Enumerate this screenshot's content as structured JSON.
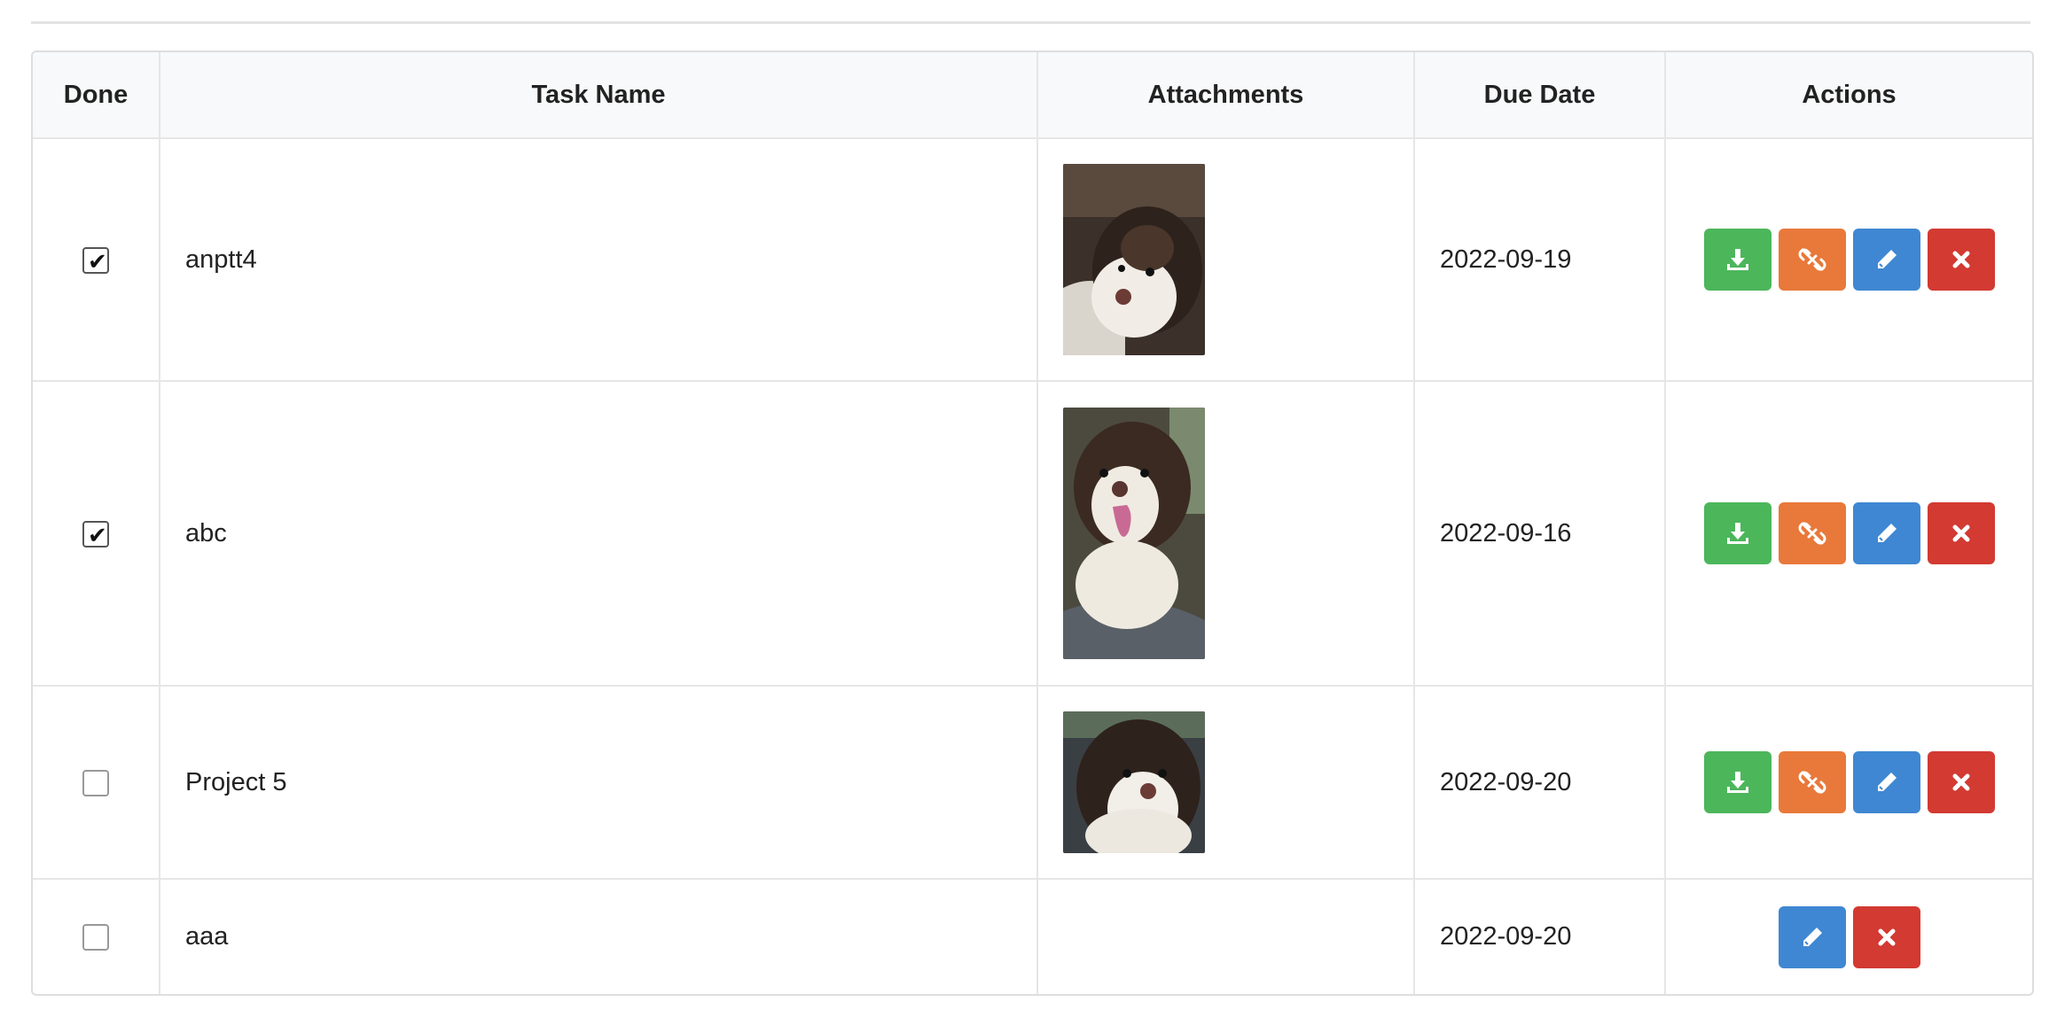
{
  "headers": {
    "done": "Done",
    "task_name": "Task Name",
    "attachments": "Attachments",
    "due_date": "Due Date",
    "actions": "Actions"
  },
  "rows": [
    {
      "done": true,
      "name": "anptt4",
      "due": "2022-09-19",
      "has_attachment": true,
      "attachment_image": "brown and white puppy lying on couch",
      "actions": [
        "download-icon",
        "unlink-icon",
        "pencil-icon",
        "close-icon"
      ]
    },
    {
      "done": true,
      "name": "abc",
      "due": "2022-09-16",
      "has_attachment": true,
      "attachment_image": "brown and white puppy with tongue out",
      "actions": [
        "download-icon",
        "unlink-icon",
        "pencil-icon",
        "close-icon"
      ]
    },
    {
      "done": false,
      "name": "Project 5",
      "due": "2022-09-20",
      "has_attachment": true,
      "attachment_image": "brown and white puppy looking up",
      "actions": [
        "download-icon",
        "unlink-icon",
        "pencil-icon",
        "close-icon"
      ]
    },
    {
      "done": false,
      "name": "aaa",
      "due": "2022-09-20",
      "has_attachment": false,
      "actions": [
        "pencil-icon",
        "close-icon"
      ]
    }
  ],
  "colors": {
    "download": "#4cb65b",
    "unlink": "#e8793a",
    "edit": "#3f87d2",
    "delete": "#d23a32",
    "header_bg": "#f8f9fa"
  }
}
